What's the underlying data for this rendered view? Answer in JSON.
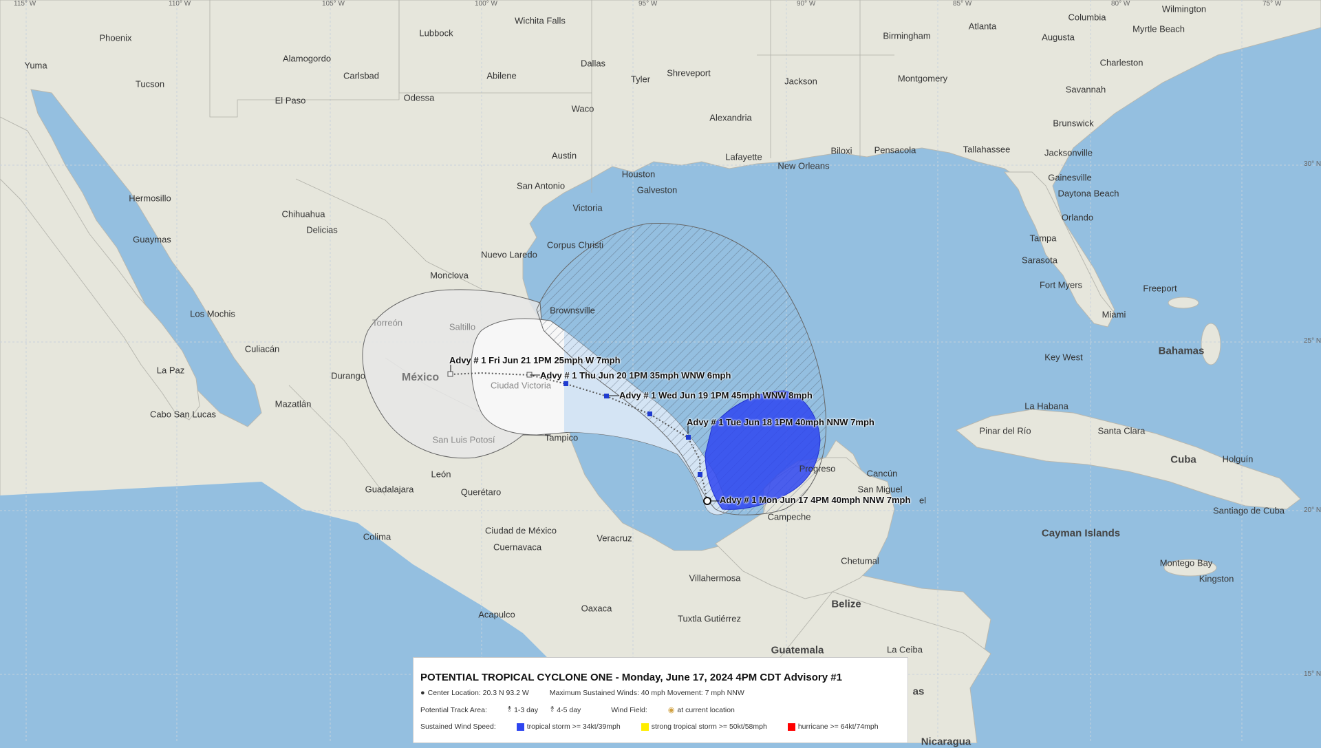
{
  "colors": {
    "water": "#94bfe0",
    "land": "#e6e6dc",
    "track_day13": "#cfe1f3",
    "track_day45": "#e6e6e6",
    "tropical_storm": "#2e45f0",
    "strong_tropical_storm": "#ffee00",
    "hurricane": "#ff0000",
    "track_point": "#1f3bd0"
  },
  "ticks": {
    "top": [
      "115° W",
      "110° W",
      "105° W",
      "100° W",
      "95° W",
      "90° W",
      "85° W",
      "80° W",
      "75° W"
    ],
    "right": [
      "30° N",
      "25° N",
      "20° N",
      "15° N"
    ]
  },
  "places": [
    {
      "id": "phoenix",
      "name": "Phoenix"
    },
    {
      "id": "yuma",
      "name": "Yuma"
    },
    {
      "id": "tucson",
      "name": "Tucson"
    },
    {
      "id": "alamogordo",
      "name": "Alamogordo"
    },
    {
      "id": "carlsbad",
      "name": "Carlsbad"
    },
    {
      "id": "elpaso",
      "name": "El Paso"
    },
    {
      "id": "lubbock",
      "name": "Lubbock"
    },
    {
      "id": "wichitafalls",
      "name": "Wichita Falls"
    },
    {
      "id": "abilene",
      "name": "Abilene"
    },
    {
      "id": "odessa",
      "name": "Odessa"
    },
    {
      "id": "dallas",
      "name": "Dallas"
    },
    {
      "id": "waco",
      "name": "Waco"
    },
    {
      "id": "tyler",
      "name": "Tyler"
    },
    {
      "id": "shreveport",
      "name": "Shreveport"
    },
    {
      "id": "jackson",
      "name": "Jackson"
    },
    {
      "id": "birmingham",
      "name": "Birmingham"
    },
    {
      "id": "atlanta",
      "name": "Atlanta"
    },
    {
      "id": "columbia",
      "name": "Columbia"
    },
    {
      "id": "wilmington",
      "name": "Wilmington"
    },
    {
      "id": "augusta",
      "name": "Augusta"
    },
    {
      "id": "myrtlebeach",
      "name": "Myrtle Beach"
    },
    {
      "id": "charleston",
      "name": "Charleston"
    },
    {
      "id": "montgomery",
      "name": "Montgomery"
    },
    {
      "id": "savannah",
      "name": "Savannah"
    },
    {
      "id": "alexandria",
      "name": "Alexandria"
    },
    {
      "id": "brunswick",
      "name": "Brunswick"
    },
    {
      "id": "austin",
      "name": "Austin"
    },
    {
      "id": "lafayette",
      "name": "Lafayette"
    },
    {
      "id": "biloxi",
      "name": "Biloxi"
    },
    {
      "id": "pensacola",
      "name": "Pensacola"
    },
    {
      "id": "tallahassee",
      "name": "Tallahassee"
    },
    {
      "id": "jacksonville",
      "name": "Jacksonville"
    },
    {
      "id": "neworleans",
      "name": "New Orleans"
    },
    {
      "id": "houston",
      "name": "Houston"
    },
    {
      "id": "galveston",
      "name": "Galveston"
    },
    {
      "id": "sanantonio",
      "name": "San Antonio"
    },
    {
      "id": "gainesville",
      "name": "Gainesville"
    },
    {
      "id": "daytona",
      "name": "Daytona Beach"
    },
    {
      "id": "hermosillo",
      "name": "Hermosillo"
    },
    {
      "id": "chihuahua",
      "name": "Chihuahua"
    },
    {
      "id": "delicias",
      "name": "Delicias"
    },
    {
      "id": "victoria",
      "name": "Victoria"
    },
    {
      "id": "orlando",
      "name": "Orlando"
    },
    {
      "id": "guaymas",
      "name": "Guaymas"
    },
    {
      "id": "corpuschristi",
      "name": "Corpus Christi"
    },
    {
      "id": "tampa",
      "name": "Tampa"
    },
    {
      "id": "nuevolaredo",
      "name": "Nuevo Laredo"
    },
    {
      "id": "sarasota",
      "name": "Sarasota"
    },
    {
      "id": "monclova",
      "name": "Monclova"
    },
    {
      "id": "fortmyers",
      "name": "Fort Myers"
    },
    {
      "id": "freeport",
      "name": "Freeport"
    },
    {
      "id": "brownsville",
      "name": "Brownsville"
    },
    {
      "id": "miami",
      "name": "Miami"
    },
    {
      "id": "losmochis",
      "name": "Los Mochis"
    },
    {
      "id": "saltillo",
      "name": "Saltillo",
      "grey": true
    },
    {
      "id": "torreon",
      "name": "Torreón",
      "grey": true
    },
    {
      "id": "culiacan",
      "name": "Culiacán"
    },
    {
      "id": "lapaz",
      "name": "La Paz"
    },
    {
      "id": "keywest",
      "name": "Key West"
    },
    {
      "id": "durango",
      "name": "Durango"
    },
    {
      "id": "ciudadvictoria",
      "name": "Ciudad Victoria",
      "grey": true
    },
    {
      "id": "mazatlan",
      "name": "Mazatlán"
    },
    {
      "id": "cabo",
      "name": "Cabo San Lucas"
    },
    {
      "id": "lahabana",
      "name": "La Habana"
    },
    {
      "id": "pinardelrio",
      "name": "Pinar del Río"
    },
    {
      "id": "santaclara",
      "name": "Santa Clara"
    },
    {
      "id": "tampico",
      "name": "Tampico"
    },
    {
      "id": "sanluispotosi",
      "name": "San Luis Potosí",
      "grey": true
    },
    {
      "id": "holguin",
      "name": "Holguín"
    },
    {
      "id": "progreso",
      "name": "Progreso"
    },
    {
      "id": "cancun",
      "name": "Cancún"
    },
    {
      "id": "leon",
      "name": "León"
    },
    {
      "id": "guadalajara",
      "name": "Guadalajara"
    },
    {
      "id": "queretaro",
      "name": "Querétaro"
    },
    {
      "id": "sanmiguel",
      "name": "San Miguel"
    },
    {
      "id": "santiagodecuba",
      "name": "Santiago de Cuba"
    },
    {
      "id": "campeche",
      "name": "Campeche"
    },
    {
      "id": "colima",
      "name": "Colima"
    },
    {
      "id": "ciudaddemexico",
      "name": "Ciudad de México"
    },
    {
      "id": "veracruz",
      "name": "Veracruz"
    },
    {
      "id": "cuernavaca",
      "name": "Cuernavaca"
    },
    {
      "id": "chetumal",
      "name": "Chetumal"
    },
    {
      "id": "montegobay",
      "name": "Montego Bay"
    },
    {
      "id": "kingston",
      "name": "Kingston"
    },
    {
      "id": "villahermosa",
      "name": "Villahermosa"
    },
    {
      "id": "oaxaca",
      "name": "Oaxaca"
    },
    {
      "id": "acapulco",
      "name": "Acapulco"
    },
    {
      "id": "tuxtla",
      "name": "Tuxtla Gutiérrez"
    },
    {
      "id": "laceiba",
      "name": "La Ceiba"
    }
  ],
  "regions": [
    {
      "id": "bahamas",
      "name": "Bahamas"
    },
    {
      "id": "cuba",
      "name": "Cuba"
    },
    {
      "id": "cayman",
      "name": "Cayman Islands"
    },
    {
      "id": "belize",
      "name": "Belize"
    },
    {
      "id": "guatemala",
      "name": "Guatemala"
    },
    {
      "id": "mexico",
      "name": "México"
    },
    {
      "id": "honduras",
      "name": "as"
    },
    {
      "id": "nicaragua",
      "name": "Nicaragua"
    }
  ],
  "stray_text": {
    "merida_fragment": "el"
  },
  "advisories": [
    {
      "id": "adv-mon",
      "text": "Advy # 1 Mon Jun 17 4PM 40mph NNW 7mph"
    },
    {
      "id": "adv-tue",
      "text": "Advy # 1 Tue Jun 18 1PM 40mph NNW 7mph"
    },
    {
      "id": "adv-wed",
      "text": "Advy # 1 Wed Jun 19 1PM 45mph WNW 8mph"
    },
    {
      "id": "adv-thu",
      "text": "Advy # 1 Thu Jun 20 1PM 35mph WNW 6mph"
    },
    {
      "id": "adv-fri",
      "text": "Advy # 1 Fri Jun 21 1PM 25mph W 7mph"
    }
  ],
  "legend": {
    "title": "POTENTIAL TROPICAL CYCLONE ONE  -   Monday, June 17, 2024 4PM CDT  Advisory #1",
    "center_location": "Center Location: 20.3 N 93.2 W",
    "max_winds": "Maximum Sustained Winds: 40 mph Movement: 7 mph NNW",
    "track_area_label": "Potential Track Area:",
    "day13": "1-3 day",
    "day45": "4-5 day",
    "wind_field_label": "Wind Field:",
    "current_location": "at current location",
    "sustained_label": "Sustained Wind Speed:",
    "ts": "tropical storm >= 34kt/39mph",
    "sts": "strong tropical storm >= 50kt/58mph",
    "hu": "hurricane >= 64kt/74mph"
  }
}
